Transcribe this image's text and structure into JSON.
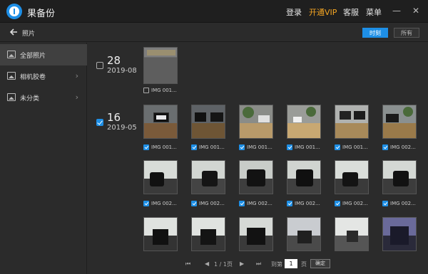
{
  "app": {
    "title": "果备份"
  },
  "titlebar": {
    "login": "登录",
    "vip": "开通VIP",
    "service": "客服",
    "menu": "菜单",
    "minimize": "—",
    "close": "✕"
  },
  "subbar": {
    "title": "照片",
    "tab_time": "时刻",
    "tab_all": "所有"
  },
  "sidebar": {
    "items": [
      {
        "label": "全部照片"
      },
      {
        "label": "相机胶卷"
      },
      {
        "label": "未分类"
      }
    ]
  },
  "groups": [
    {
      "day": "28",
      "ym": "2019-08",
      "checked": false,
      "captions": [
        "IMG 001..."
      ]
    },
    {
      "day": "16",
      "ym": "2019-05",
      "checked": true,
      "captions": [
        "IMG 001...",
        "IMG 001...",
        "IMG 001...",
        "IMG 001...",
        "IMG 001...",
        "IMG 002...",
        "IMG 002...",
        "IMG 002...",
        "IMG 002...",
        "IMG 002...",
        "IMG 002...",
        "IMG 002..."
      ]
    }
  ],
  "pager": {
    "page": "1 / 1页",
    "goto": "到第",
    "page_value": "1",
    "page_unit": "页",
    "confirm": "确定"
  },
  "colors": {
    "accent": "#1e8fe6",
    "vip": "#f5a623"
  }
}
